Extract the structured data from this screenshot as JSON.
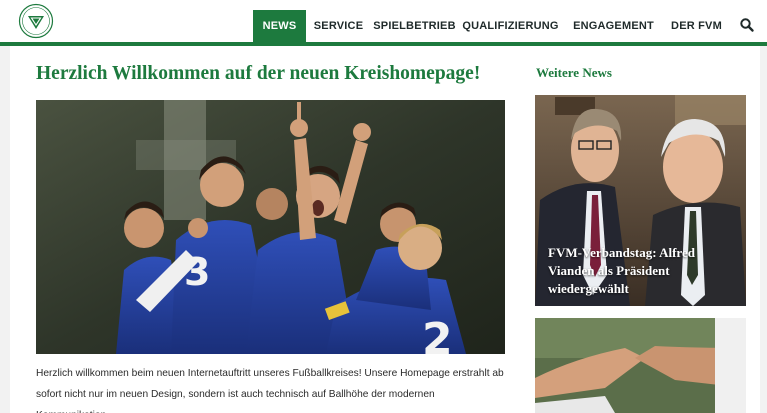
{
  "nav": {
    "items": [
      {
        "label": "NEWS",
        "active": true
      },
      {
        "label": "SERVICE"
      },
      {
        "label": "SPIELBETRIEB"
      },
      {
        "label": "QUALIFIZIERUNG"
      },
      {
        "label": "ENGAGEMENT"
      },
      {
        "label": "DER FVM"
      }
    ],
    "search_icon": "search-icon"
  },
  "logo": {
    "icon": "dfb-logo"
  },
  "main": {
    "title": "Herzlich Willkommen auf der neuen Kreishomepage!",
    "intro": "Herzlich willkommen beim neuen Internetauftritt unseres Fußballkreises! Unsere Homepage erstrahlt ab sofort nicht nur im neuen Design, sondern ist auch technisch auf Ballhöhe der modernen Kommunikation."
  },
  "sidebar": {
    "title": "Weitere News",
    "cards": [
      {
        "caption": "FVM-Verbandstag: Alfred Vianden als Präsident wiedergewählt"
      }
    ]
  },
  "colors": {
    "brand": "#1d7a3e"
  }
}
